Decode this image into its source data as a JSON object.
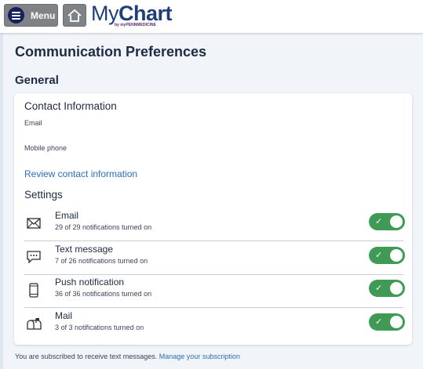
{
  "header": {
    "menu_label": "Menu",
    "logo_my": "My",
    "logo_chart": "Chart",
    "logo_sub": "by myPENNMEDICINE"
  },
  "page": {
    "title": "Communication Preferences",
    "section": "General"
  },
  "contact": {
    "title": "Contact Information",
    "email_label": "Email",
    "mobile_label": "Mobile phone",
    "review_link": "Review contact information"
  },
  "settings": {
    "title": "Settings",
    "items": [
      {
        "name": "Email",
        "status": "29 of 29 notifications turned on",
        "icon": "envelope-icon",
        "enabled": true
      },
      {
        "name": "Text message",
        "status": "7 of 26 notifications turned on",
        "icon": "message-bubble-icon",
        "enabled": true
      },
      {
        "name": "Push notification",
        "status": "36 of 36 notifications turned on",
        "icon": "smartphone-icon",
        "enabled": true
      },
      {
        "name": "Mail",
        "status": "3 of 3 notifications turned on",
        "icon": "mailbox-icon",
        "enabled": true
      }
    ]
  },
  "footer": {
    "note": "You are subscribed to receive text messages.",
    "link": "Manage your subscription"
  },
  "colors": {
    "toggle_on": "#3f9a56",
    "link": "#2a6ebb",
    "brand_navy": "#14215c"
  }
}
